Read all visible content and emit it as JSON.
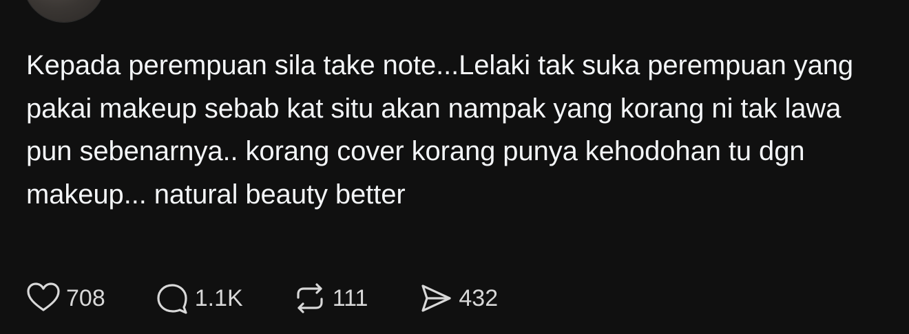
{
  "post": {
    "text": "Kepada perempuan sila take note...Lelaki tak suka perempuan yang pakai makeup sebab kat situ akan nampak yang korang ni tak lawa pun sebenarnya.. korang cover korang punya kehodohan tu dgn makeup... natural beauty better"
  },
  "actions": {
    "like": {
      "icon": "heart-icon",
      "count": "708"
    },
    "reply": {
      "icon": "comment-icon",
      "count": "1.1K"
    },
    "repost": {
      "icon": "repost-icon",
      "count": "111"
    },
    "share": {
      "icon": "send-icon",
      "count": "432"
    }
  },
  "colors": {
    "background": "#101010",
    "text": "#f3f5f7",
    "icon": "#d8d8d8"
  }
}
